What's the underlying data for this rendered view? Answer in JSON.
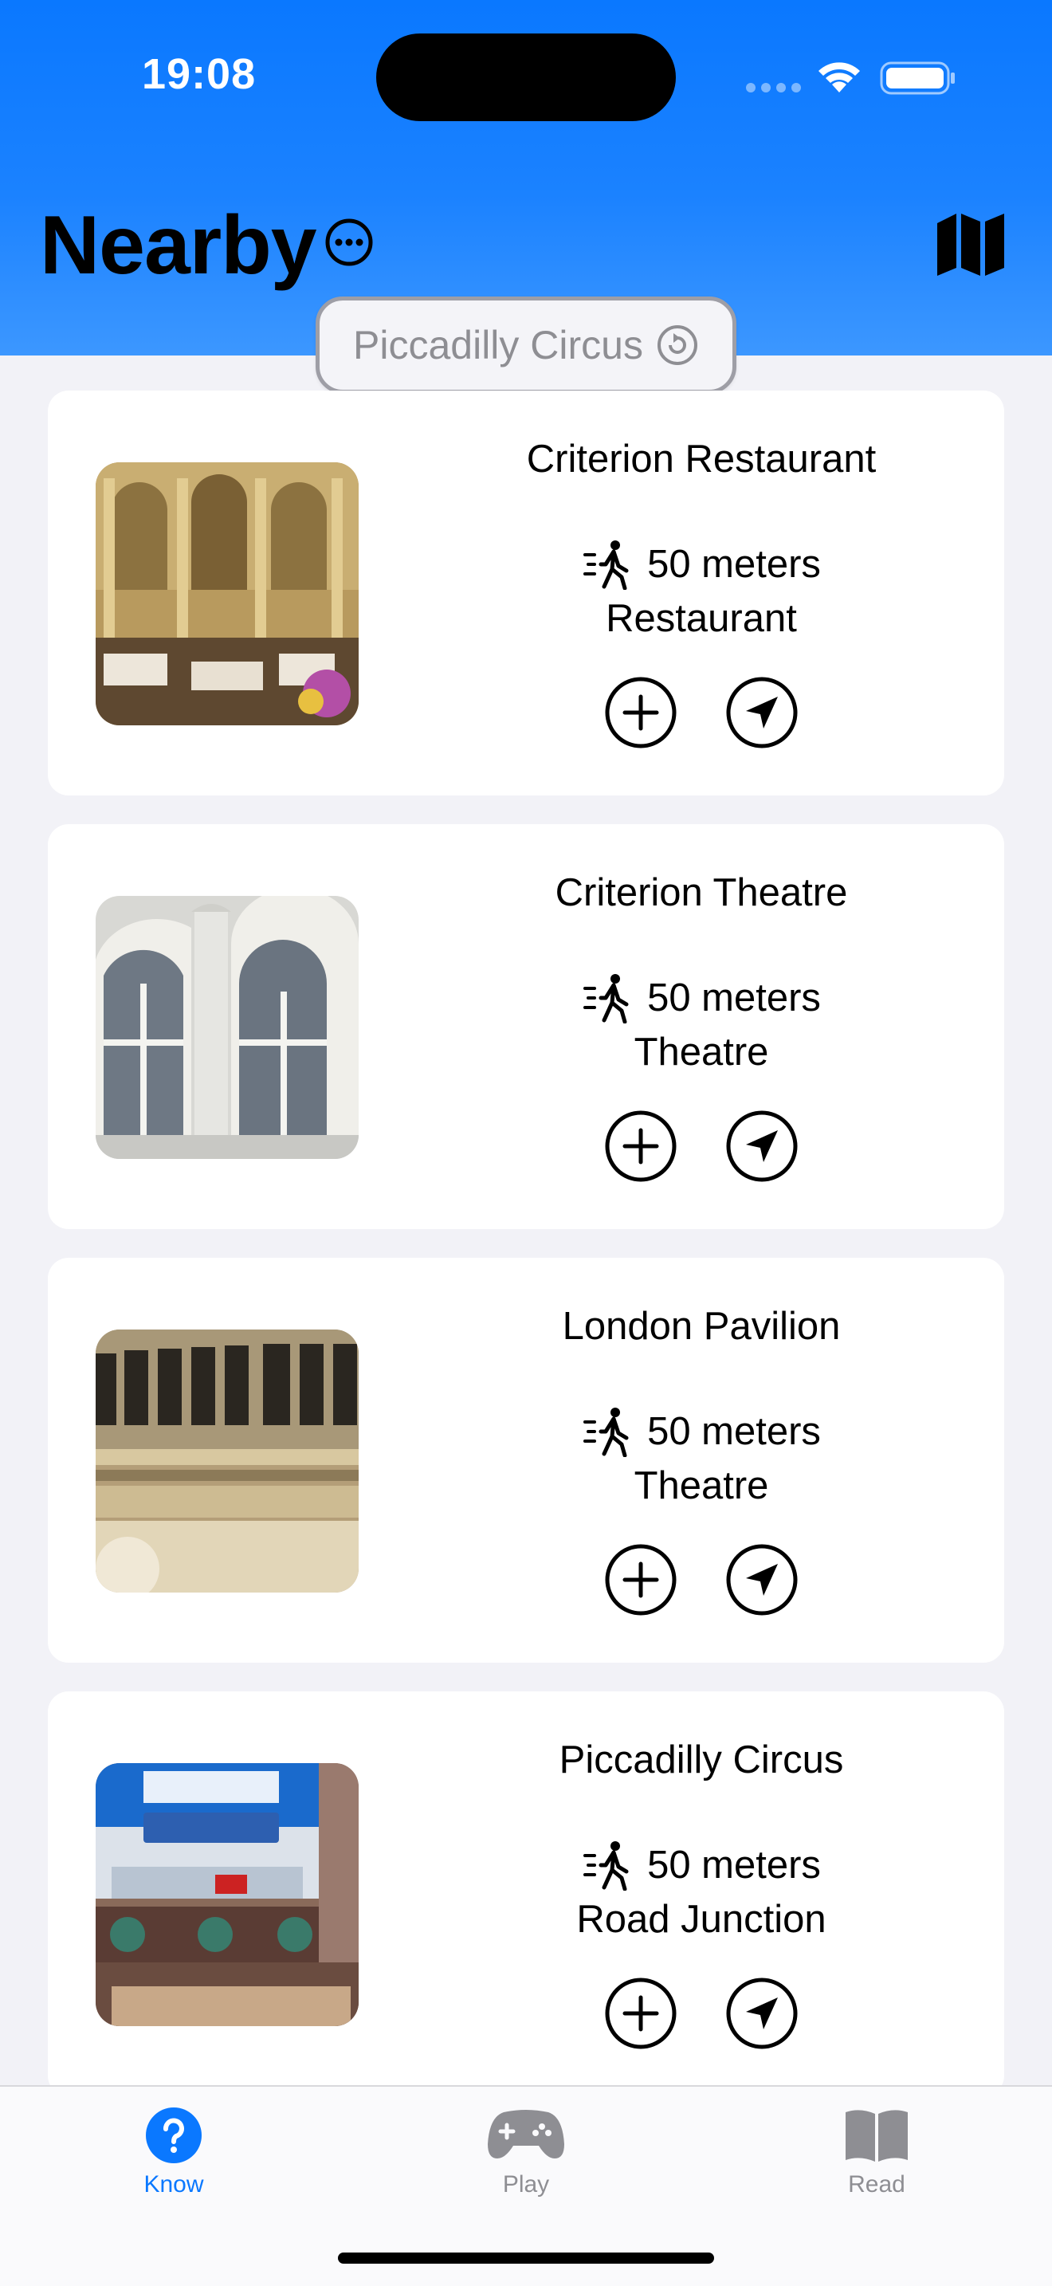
{
  "status_bar": {
    "time": "19:08"
  },
  "header": {
    "title": "Nearby",
    "location": "Piccadilly Circus"
  },
  "places": [
    {
      "name": "Criterion Restaurant",
      "distance": "50 meters",
      "category": "Restaurant"
    },
    {
      "name": "Criterion Theatre",
      "distance": "50 meters",
      "category": "Theatre"
    },
    {
      "name": "London Pavilion",
      "distance": "50 meters",
      "category": "Theatre"
    },
    {
      "name": "Piccadilly Circus",
      "distance": "50 meters",
      "category": "Road Junction"
    }
  ],
  "tab_bar": {
    "tabs": [
      {
        "label": "Know",
        "icon": "question-circle-icon",
        "active": true
      },
      {
        "label": "Play",
        "icon": "gamecontroller-icon",
        "active": false
      },
      {
        "label": "Read",
        "icon": "book-icon",
        "active": false
      }
    ]
  },
  "colors": {
    "accent": "#0A78FF",
    "header_gradient_top": "#0A78FF",
    "header_gradient_bottom": "#3C97FF",
    "background": "#F2F2F7",
    "inactive_tab": "#8E8E93"
  }
}
